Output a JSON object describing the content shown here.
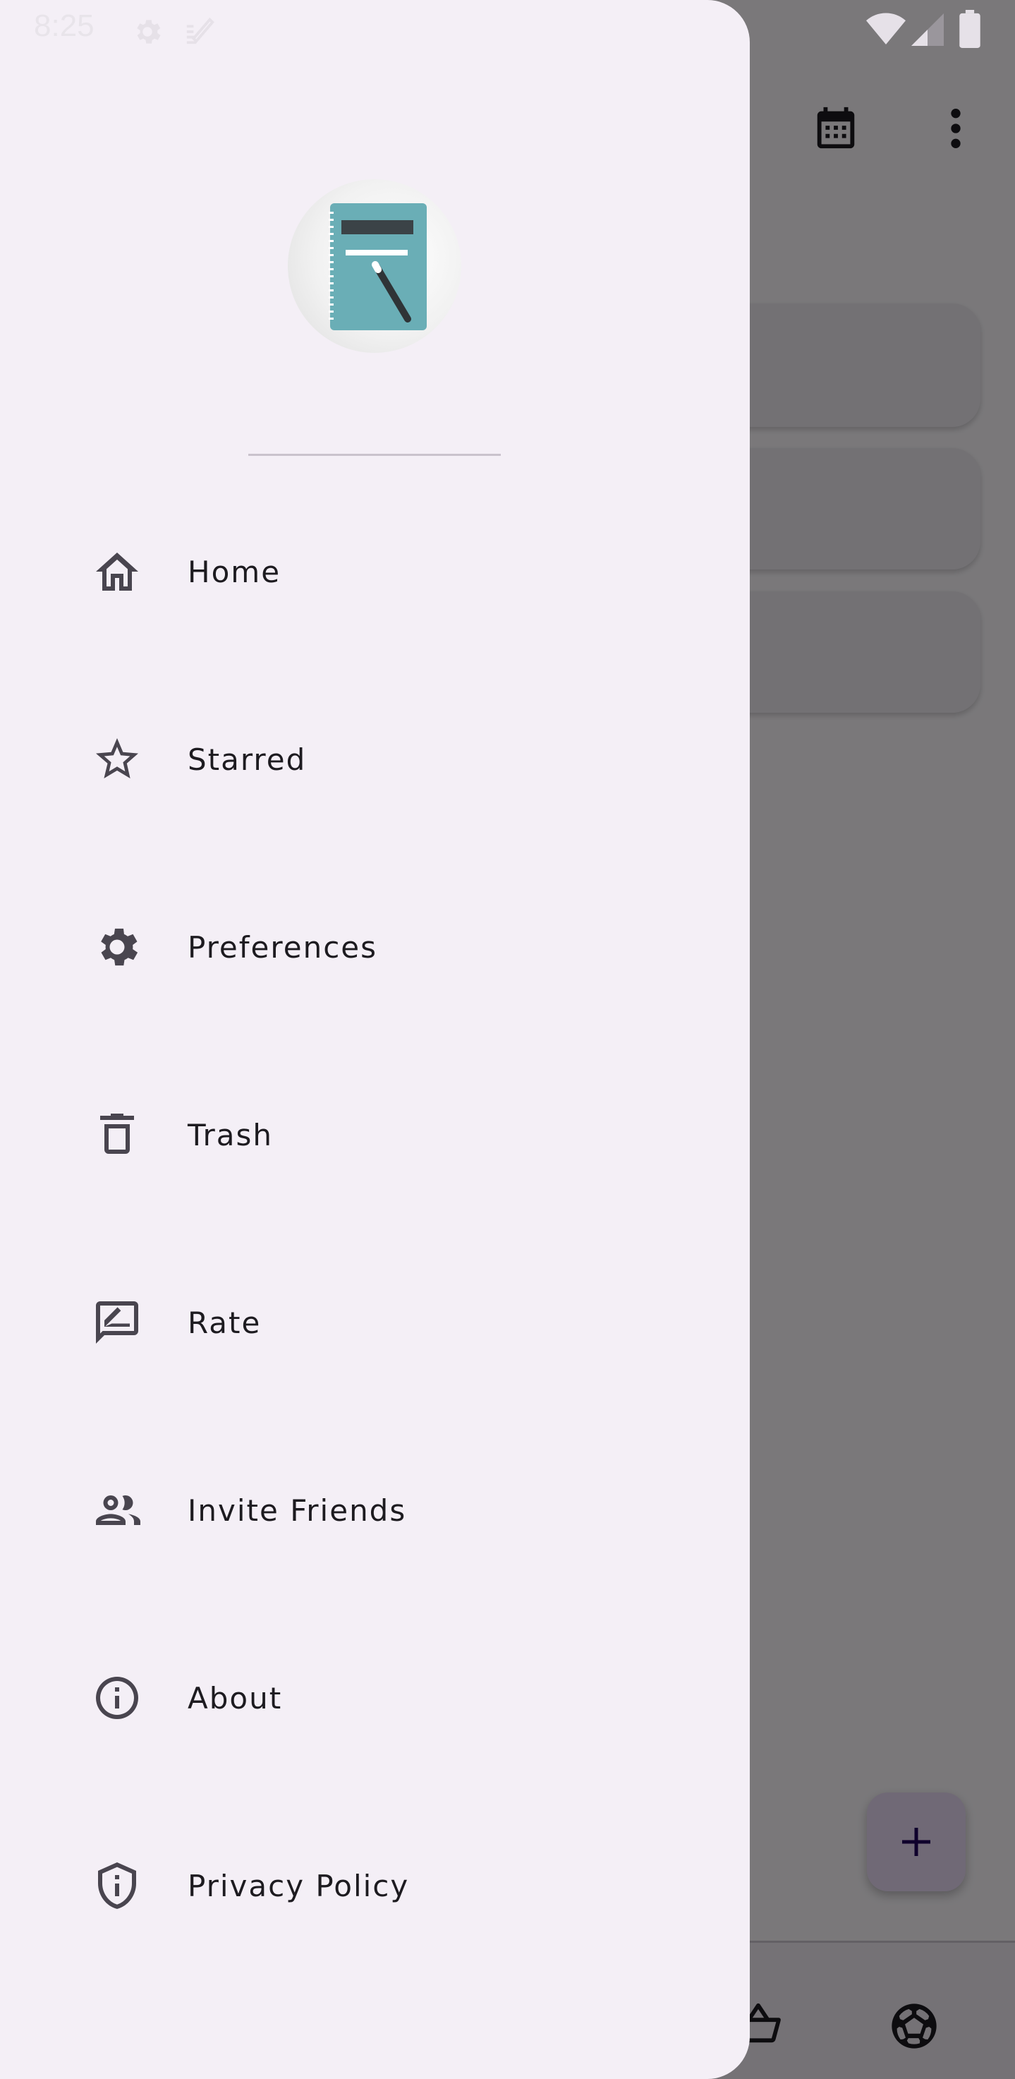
{
  "status_bar": {
    "time": "8:25"
  },
  "drawer": {
    "items": [
      {
        "label": "Home"
      },
      {
        "label": "Starred"
      },
      {
        "label": "Preferences"
      },
      {
        "label": "Trash"
      },
      {
        "label": "Rate"
      },
      {
        "label": "Invite Friends"
      },
      {
        "label": "About"
      },
      {
        "label": "Privacy Policy"
      }
    ]
  },
  "colors": {
    "drawer_bg": "#f4eff6",
    "icon": "#49454f",
    "text": "#1d1b20",
    "logo_teal": "#6aaeb6"
  },
  "icons": [
    "settings-icon",
    "edit-icon",
    "wifi-icon",
    "signal-icon",
    "battery-icon",
    "calendar-icon",
    "more-vert-icon",
    "home-icon",
    "star-icon",
    "gear-icon",
    "trash-icon",
    "rate-review-icon",
    "group-icon",
    "info-icon",
    "shield-icon",
    "add-icon",
    "basket-icon",
    "soccer-ball-icon"
  ]
}
